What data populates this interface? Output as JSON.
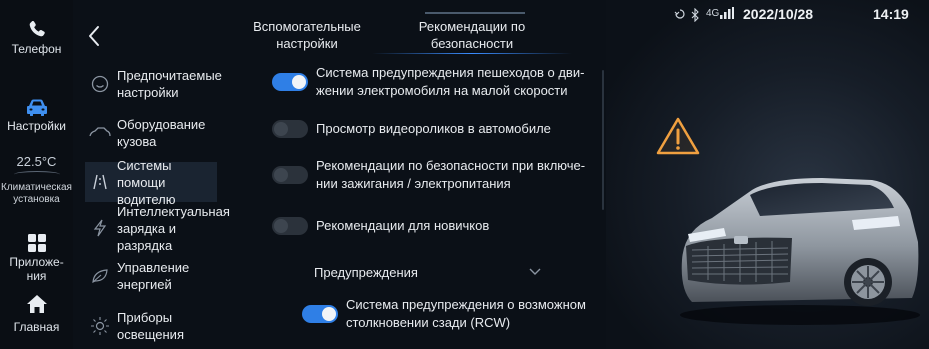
{
  "dock": {
    "phone_label": "Телефон",
    "settings_label": "Настройки",
    "temperature": "22.5°C",
    "climate_label": "Климатическая\nустановка",
    "apps_label": "Приложе-\nния",
    "home_label": "Главная"
  },
  "tabs": [
    {
      "label": "Вспомогательные\nнастройки"
    },
    {
      "label": "Рекомендации по\nбезопасности"
    }
  ],
  "menu": [
    {
      "label": "Предпочитаемые\nнастройки",
      "icon": "smile-icon"
    },
    {
      "label": "Оборудование\nкузова",
      "icon": "car-body-icon"
    },
    {
      "label": "Системы помощи\nводителю",
      "icon": "lane-assist-icon"
    },
    {
      "label": "Интеллектуальная\nзарядка и разрядка",
      "icon": "charge-icon"
    },
    {
      "label": "Управление\nэнергией",
      "icon": "leaf-icon"
    },
    {
      "label": "Приборы освещения",
      "icon": "light-icon"
    }
  ],
  "settings": [
    {
      "label": "Система предупреждения пешеходов о дви-\nжении электромобиля на малой скорости",
      "on": true
    },
    {
      "label": "Просмотр видеороликов в автомобиле",
      "on": false
    },
    {
      "label": "Рекомендации по безопасности при включе-\nнии зажигания / электропитания",
      "on": false
    },
    {
      "label": "Рекомендации для новичков",
      "on": false
    }
  ],
  "dropdown": {
    "label": "Предупреждения"
  },
  "rcw": {
    "label": "Система предупреждения о возможном\nстолкновении сзади (RCW)",
    "on": true
  },
  "status": {
    "signal": "4G",
    "date": "2022/10/28",
    "time": "14:19"
  },
  "colors": {
    "accent": "#2f7fe6",
    "warning": "#f0a040"
  }
}
